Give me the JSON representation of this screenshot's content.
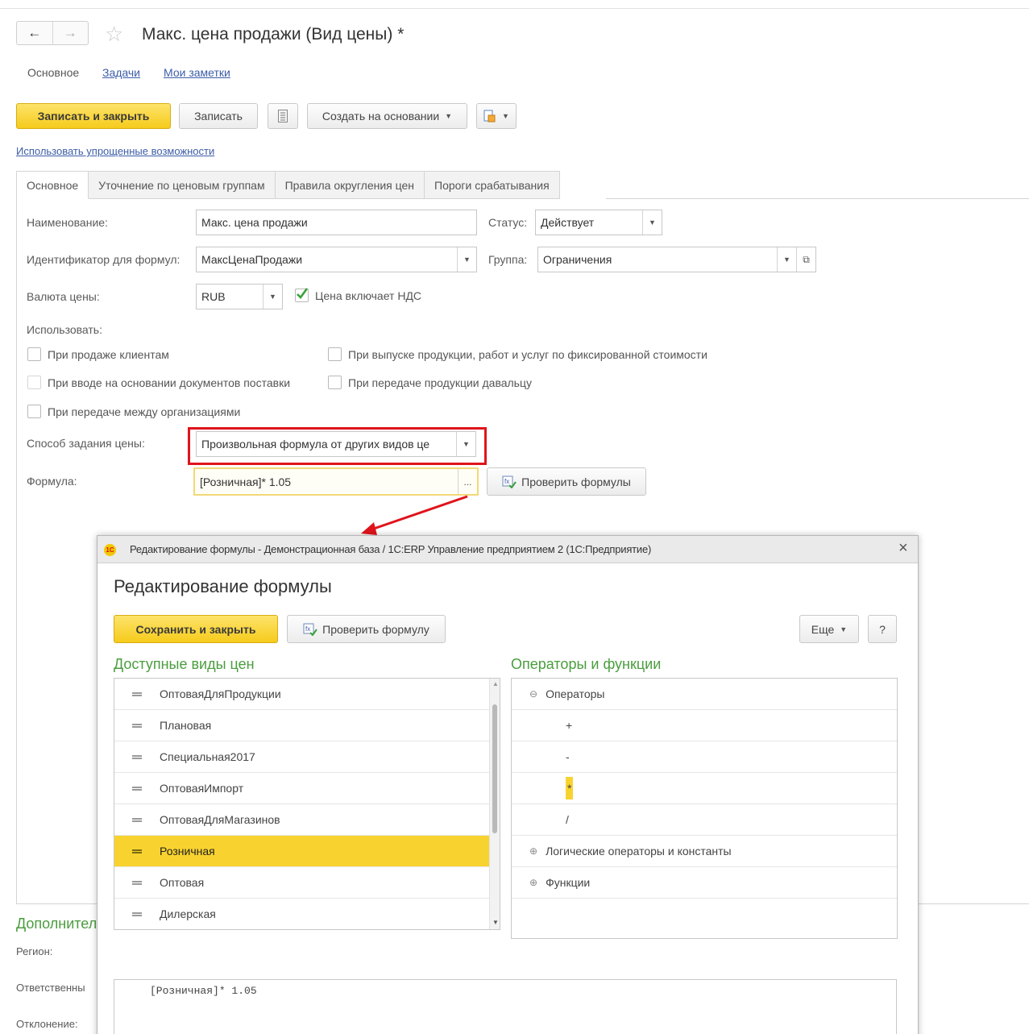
{
  "window": {
    "title": "Макс. цена продажи (Вид цены) *",
    "nav_back": "←",
    "nav_forward": "→"
  },
  "subnav": {
    "main": "Основное",
    "tasks": "Задачи",
    "notes": "Мои заметки"
  },
  "toolbar": {
    "save_close": "Записать и закрыть",
    "save": "Записать",
    "create_based": "Создать на основании",
    "simplified_link": "Использовать упрощенные возможности"
  },
  "tabs": [
    "Основное",
    "Уточнение по ценовым группам",
    "Правила округления цен",
    "Пороги срабатывания"
  ],
  "form": {
    "name_label": "Наименование:",
    "name_value": "Макс. цена продажи",
    "status_label": "Статус:",
    "status_value": "Действует",
    "id_label": "Идентификатор для формул:",
    "id_value": "МаксЦенаПродажи",
    "group_label": "Группа:",
    "group_value": "Ограничения",
    "currency_label": "Валюта цены:",
    "currency_value": "RUB",
    "vat_label": "Цена включает НДС",
    "vat_checked": true,
    "use_label": "Использовать:",
    "checkboxes": [
      "При продаже клиентам",
      "При вводе на основании документов поставки",
      "При передаче между организациями",
      "При выпуске продукции, работ и услуг по фиксированной стоимости",
      "При передаче продукции давальцу"
    ],
    "method_label": "Способ задания цены:",
    "method_value": "Произвольная формула от других видов це",
    "formula_label": "Формула:",
    "formula_value": "[Розничная]* 1.05",
    "formula_btn_dots": "...",
    "check_formulas": "Проверить формулы"
  },
  "bottom_section": {
    "header": "Дополнител",
    "region": "Регион:",
    "responsible": "Ответственны",
    "deviation": "Отклонение:"
  },
  "dialog": {
    "caption": "Редактирование формулы - Демонстрационная база / 1С:ERP Управление предприятием 2  (1С:Предприятие)",
    "title": "Редактирование формулы",
    "save_close": "Сохранить и закрыть",
    "check_formula": "Проверить формулу",
    "more": "Еще",
    "help": "?",
    "close": "×",
    "prices_header": "Доступные виды цен",
    "price_types": [
      "ОптоваяДляПродукции",
      "Плановая",
      "Специальная2017",
      "ОптоваяИмпорт",
      "ОптоваяДляМагазинов",
      "Розничная",
      "Оптовая",
      "Дилерская"
    ],
    "selected_price": "Розничная",
    "ops_header": "Операторы и функции",
    "ops": {
      "operators": "Операторы",
      "plus": "+",
      "minus": "-",
      "mult": "*",
      "div": "/",
      "logical": "Логические операторы и константы",
      "functions": "Функции"
    },
    "formula_text": "[Розничная]* 1.05"
  },
  "colors": {
    "accent_yellow": "#f8d32f",
    "highlight_red": "#e0141b",
    "header_green": "#4a9d3e",
    "link_blue": "#3d5da8"
  }
}
